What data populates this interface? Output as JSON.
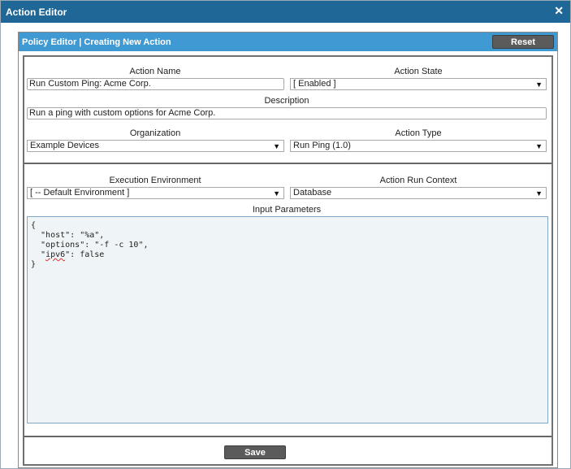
{
  "window": {
    "title": "Action Editor",
    "close_glyph": "✕"
  },
  "panel": {
    "title": "Policy Editor | Creating New Action",
    "reset_label": "Reset"
  },
  "form": {
    "action_name": {
      "label": "Action Name",
      "value": "Run Custom Ping: Acme Corp."
    },
    "action_state": {
      "label": "Action State",
      "value": "[ Enabled ]"
    },
    "description": {
      "label": "Description",
      "value": "Run a ping with custom options for Acme Corp."
    },
    "organization": {
      "label": "Organization",
      "value": "Example Devices"
    },
    "action_type": {
      "label": "Action Type",
      "value": "Run Ping (1.0)"
    },
    "execution_environment": {
      "label": "Execution Environment",
      "value": "[ -- Default Environment ]"
    },
    "action_run_context": {
      "label": "Action Run Context",
      "value": "Database"
    },
    "input_parameters": {
      "label": "Input Parameters",
      "lines": [
        "{",
        "  \"host\": \"%a\",",
        "  \"options\": \"-f -c 10\",",
        "  \"",
        "ipv6",
        "\": false",
        "}"
      ]
    },
    "save_label": "Save"
  },
  "icons": {
    "close": "close-icon",
    "dropdown": "chevron-down-icon"
  },
  "colors": {
    "titlebar": "#1f6797",
    "panel_header": "#3f99d3",
    "button": "#5b5b5b",
    "editor_bg": "#eff4f6"
  }
}
